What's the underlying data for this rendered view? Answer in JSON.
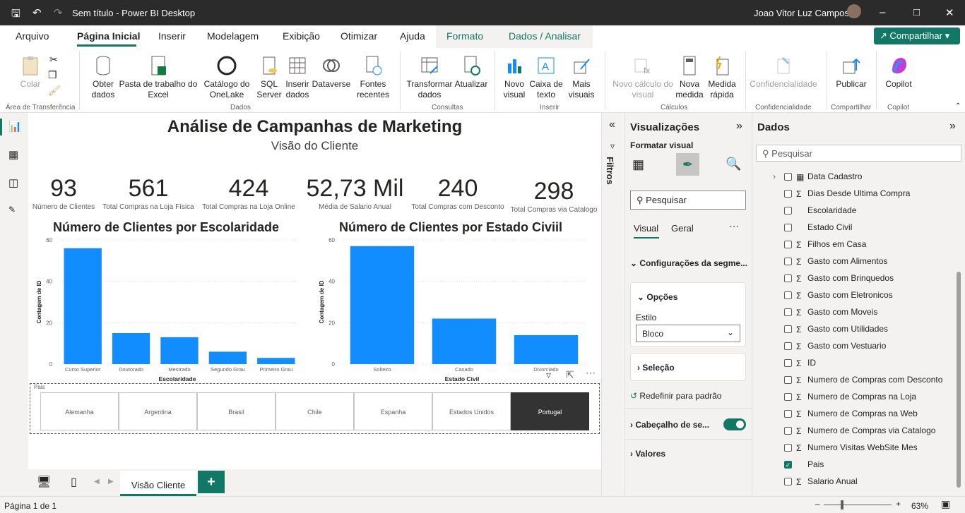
{
  "window": {
    "title": "Sem título - Power BI Desktop",
    "user": "Joao Vitor Luz Campos"
  },
  "menu": {
    "tabs": [
      "Arquivo",
      "Página Inicial",
      "Inserir",
      "Modelagem",
      "Exibição",
      "Otimizar",
      "Ajuda",
      "Formato",
      "Dados / Analisar"
    ],
    "share": "Compartilhar"
  },
  "ribbon": {
    "colar": "Colar",
    "obter": "Obter dados",
    "pasta": "Pasta de trabalho do Excel",
    "catalogo": "Catálogo do OneLake",
    "sql": "SQL Server",
    "inserir_dados": "Inserir dados",
    "dataverse": "Dataverse",
    "fontes": "Fontes recentes",
    "transformar": "Transformar dados",
    "atualizar": "Atualizar",
    "novo_visual": "Novo visual",
    "caixa": "Caixa de texto",
    "mais_visuais": "Mais visuais",
    "novo_calc": "Novo cálculo do visual",
    "nova_medida": "Nova medida",
    "medida_rapida": "Medida rápida",
    "confid": "Confidencialidade",
    "publicar": "Publicar",
    "copilot": "Copilot",
    "groups": [
      "Área de Transferência",
      "Dados",
      "Consultas",
      "Inserir",
      "Cálculos",
      "Confidencialidade",
      "Compartilhar",
      "Copilot"
    ]
  },
  "report": {
    "title": "Análise de Campanhas de Marketing",
    "subtitle": "Visão do Cliente"
  },
  "kpis": [
    {
      "value": "93",
      "label": "Número de Clientes"
    },
    {
      "value": "561",
      "label": "Total Compras na Loja Física"
    },
    {
      "value": "424",
      "label": "Total Compras na Loja Online"
    },
    {
      "value": "52,73 Mil",
      "label": "Média de Salario Anual"
    },
    {
      "value": "240",
      "label": "Total Compras com Desconto"
    },
    {
      "value": "298",
      "label": "Total Compras via Catalogo"
    }
  ],
  "chart_data": [
    {
      "type": "bar",
      "title": "Número de Clientes por Escolaridade",
      "xlabel": "Escolaridade",
      "ylabel": "Contagem de ID",
      "ylim": [
        0,
        60
      ],
      "yticks": [
        0,
        20,
        40,
        60
      ],
      "categories": [
        "Curso Superior",
        "Doutorado",
        "Mestrado",
        "Segundo Grau",
        "Primeiro Grau"
      ],
      "values": [
        56,
        15,
        13,
        6,
        3
      ],
      "color": "#118dff"
    },
    {
      "type": "bar",
      "title": "Número de Clientes por Estado Civiil",
      "xlabel": "Estado Civil",
      "ylabel": "Contagem de ID",
      "ylim": [
        0,
        60
      ],
      "yticks": [
        0,
        20,
        40,
        60
      ],
      "categories": [
        "Solteiro",
        "Casado",
        "Divorciado"
      ],
      "values": [
        57,
        22,
        14
      ],
      "color": "#118dff"
    }
  ],
  "slicer": {
    "title": "Pais",
    "options": [
      "Alemanha",
      "Argentina",
      "Brasil",
      "Chile",
      "Espanha",
      "Estados Unidos",
      "Portugal"
    ],
    "selected": "Portugal"
  },
  "pages": {
    "current": "Visão Cliente"
  },
  "status": {
    "page": "Página 1 de 1",
    "zoom": "63%"
  },
  "filters": {
    "label": "Filtros"
  },
  "viz": {
    "title": "Visualizações",
    "format": "Formatar visual",
    "search": "Pesquisar",
    "tab_visual": "Visual",
    "tab_geral": "Geral",
    "section_config": "Configurações da segme...",
    "opcoes": "Opções",
    "estilo": "Estilo",
    "estilo_val": "Bloco",
    "selecao": "Seleção",
    "reset": "Redefinir para padrão",
    "cabecalho": "Cabeçalho de se...",
    "valores": "Valores"
  },
  "data": {
    "title": "Dados",
    "search": "Pesquisar",
    "fields": [
      {
        "name": "Data Cadastro",
        "sigma": false,
        "checked": false,
        "table": true
      },
      {
        "name": "Dias Desde Ultima Compra",
        "sigma": true,
        "checked": false
      },
      {
        "name": "Escolaridade",
        "sigma": false,
        "checked": false
      },
      {
        "name": "Estado Civil",
        "sigma": false,
        "checked": false
      },
      {
        "name": "Filhos em Casa",
        "sigma": true,
        "checked": false
      },
      {
        "name": "Gasto com Alimentos",
        "sigma": true,
        "checked": false
      },
      {
        "name": "Gasto com Brinquedos",
        "sigma": true,
        "checked": false
      },
      {
        "name": "Gasto com Eletronicos",
        "sigma": true,
        "checked": false
      },
      {
        "name": "Gasto com Moveis",
        "sigma": true,
        "checked": false
      },
      {
        "name": "Gasto com Utilidades",
        "sigma": true,
        "checked": false
      },
      {
        "name": "Gasto com Vestuario",
        "sigma": true,
        "checked": false
      },
      {
        "name": "ID",
        "sigma": true,
        "checked": false
      },
      {
        "name": "Numero de Compras com Desconto",
        "sigma": true,
        "checked": false
      },
      {
        "name": "Numero de Compras na Loja",
        "sigma": true,
        "checked": false
      },
      {
        "name": "Numero de Compras na Web",
        "sigma": true,
        "checked": false
      },
      {
        "name": "Numero de Compras via Catalogo",
        "sigma": true,
        "checked": false
      },
      {
        "name": "Numero Visitas WebSite Mes",
        "sigma": true,
        "checked": false
      },
      {
        "name": "Pais",
        "sigma": false,
        "checked": true
      },
      {
        "name": "Salario Anual",
        "sigma": true,
        "checked": false
      }
    ]
  }
}
